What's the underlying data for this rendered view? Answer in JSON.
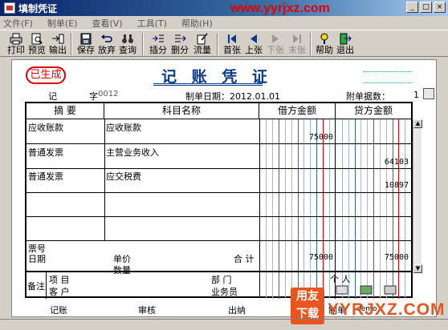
{
  "window": {
    "title": "填制凭证",
    "watermark": "www.yyrjxz.com",
    "min_glyph": "_",
    "max_glyph": "□",
    "close_glyph": "×"
  },
  "menu": [
    "文件(F)",
    "制单(E)",
    "查看(V)",
    "工具(T)",
    "帮助(H)"
  ],
  "toolbar": {
    "print": "打印",
    "preview": "预览",
    "export": "输出",
    "save": "保存",
    "discard": "放弃",
    "query": "查询",
    "insert": "插分",
    "delete": "删分",
    "flow": "流量",
    "first": "首张",
    "prev": "上张",
    "next": "下张",
    "last": "末张",
    "help": "帮助",
    "exit": "退出"
  },
  "voucher": {
    "stamp": "已生成",
    "title": "记 账 凭 证",
    "ji": "记",
    "zi": "字",
    "number": "0012",
    "date_label": "制单日期：",
    "date": "2012.01.01",
    "attach_label": "附单据数：",
    "attach_count": "1",
    "headers": {
      "summary": "摘 要",
      "account": "科目名称",
      "debit": "借方金额",
      "credit": "贷方金额"
    },
    "rows": [
      {
        "summary": "应收账款",
        "account": "应收账款",
        "debit": "75000",
        "credit": ""
      },
      {
        "summary": "普通发票",
        "account": "主营业务收入",
        "debit": "",
        "credit": "64103"
      },
      {
        "summary": "普通发票",
        "account": "应交税费",
        "debit": "",
        "credit": "10897"
      },
      {
        "summary": "",
        "account": "",
        "debit": "",
        "credit": ""
      },
      {
        "summary": "",
        "account": "",
        "debit": "",
        "credit": ""
      }
    ],
    "footer": {
      "ticket_no": "票号",
      "date": "日期",
      "unit_price": "单价",
      "quantity": "数量",
      "total_label": "合 计",
      "debit_total": "75000",
      "credit_total": "75000"
    },
    "notes": {
      "label": "备注",
      "project": "项 目",
      "dept": "部 门",
      "person": "个 人",
      "customer": "客 户",
      "salesman": "业务员"
    },
    "signatures": {
      "bookkeep": "记账",
      "audit": "审核",
      "cashier": "出纳",
      "maker": "制单",
      "maker_name": "demo"
    }
  },
  "logo": {
    "line1": "用友",
    "line2": "下载",
    "site": "YYRJXZ.COM"
  },
  "colors": {
    "title_blue": "#0a3a8a",
    "stamp_red": "#dd0000",
    "watermark_red": "#e60000"
  }
}
